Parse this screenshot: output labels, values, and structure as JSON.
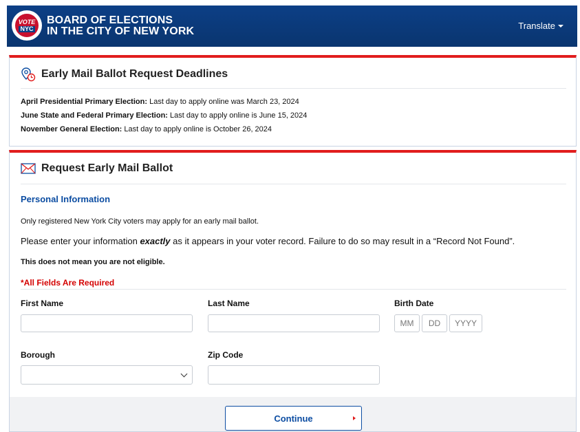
{
  "header": {
    "logo_top": "VOTE",
    "logo_bottom": "NYC",
    "org_line1": "BOARD OF ELECTIONS",
    "org_line2": "IN THE CITY OF NEW YORK",
    "translate_label": "Translate"
  },
  "deadlines": {
    "title": "Early Mail Ballot Request Deadlines",
    "items": [
      {
        "name": "April Presidential Primary Election:",
        "text": "Last day to apply online was March 23, 2024"
      },
      {
        "name": "June State and Federal Primary Election:",
        "text": "Last day to apply online is June 15, 2024"
      },
      {
        "name": "November General Election:",
        "text": "Last day to apply online is October 26, 2024"
      }
    ]
  },
  "request": {
    "title": "Request Early Mail Ballot",
    "section_title": "Personal Information",
    "info1": "Only registered New York City voters may apply for an early mail ballot.",
    "info2_before": "Please enter your information ",
    "info2_em": "exactly",
    "info2_after": " as it appears in your voter record. Failure to do so may result in a “Record Not Found”.",
    "info3": "This does not mean you are not eligible.",
    "required_note": "*All Fields Are Required",
    "fields": {
      "first_name_label": "First Name",
      "first_name_value": "",
      "last_name_label": "Last Name",
      "last_name_value": "",
      "birth_date_label": "Birth Date",
      "month_placeholder": "MM",
      "day_placeholder": "DD",
      "year_placeholder": "YYYY",
      "borough_label": "Borough",
      "borough_value": "",
      "zip_label": "Zip Code",
      "zip_value": ""
    },
    "continue_label": "Continue"
  },
  "colors": {
    "header_blue": "#0c3f86",
    "accent_red": "#e11d1d",
    "link_blue": "#0c4da2",
    "required_red": "#d40000"
  }
}
